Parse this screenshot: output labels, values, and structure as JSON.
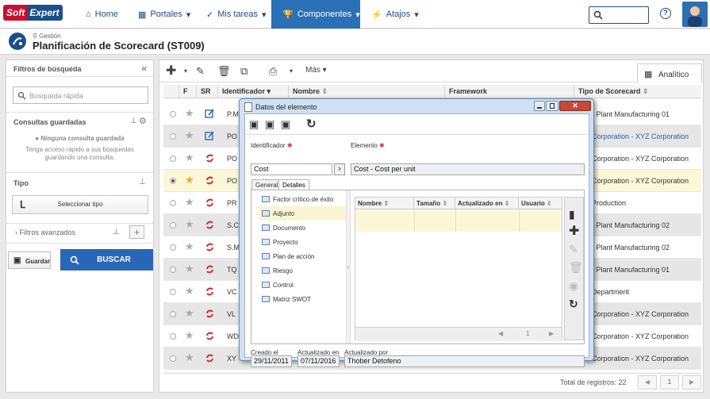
{
  "header": {
    "logo_soft": "Soft",
    "logo_expert": "Expert",
    "nav": [
      {
        "icon": "home-icon",
        "label": "Home"
      },
      {
        "icon": "grid-icon",
        "label": "Portales"
      },
      {
        "icon": "check-icon",
        "label": "Mis tareas"
      },
      {
        "icon": "trophy-icon",
        "label": "Componentes"
      },
      {
        "icon": "bolt-icon",
        "label": "Atajos"
      }
    ]
  },
  "page": {
    "breadcrumb": "Gestión",
    "title": "Planificación de Scorecard (ST009)"
  },
  "left_panel": {
    "title": "Filtros de búsqueda",
    "quick_search_placeholder": "Búsqueda rápida",
    "saved_title": "Consultas guardadas",
    "no_saved": "Ninguna consulta guardada",
    "saved_hint_1": "Tenga acceso rápido a sus búsquedas",
    "saved_hint_2": "guardando una consulta.",
    "tipo_title": "Tipo",
    "select_type": "Seleccionar tipo",
    "advanced_filters": "Filtros avanzados",
    "save": "Guardar",
    "search": "BUSCAR"
  },
  "grid": {
    "toolbar_more": "Más",
    "tab_analytic": "Analítico",
    "columns": [
      "F",
      "SR",
      "Identificador",
      "Nombre",
      "Framework",
      "Tipo de Scorecard"
    ],
    "rows": [
      {
        "id": "P.M",
        "tipo": "- Plant Manufacturing 01",
        "star": false,
        "status": "edit",
        "style": "",
        "tipo_blue": false
      },
      {
        "id": "PO",
        "tipo": "Corporation - XYZ Corporation",
        "star": false,
        "status": "edit",
        "style": "alt",
        "tipo_blue": true
      },
      {
        "id": "PO",
        "tipo": "Corporation - XYZ Corporation",
        "star": false,
        "status": "cycle",
        "style": "",
        "tipo_blue": false
      },
      {
        "id": "PO",
        "tipo": "Corporation - XYZ Corporation",
        "star": true,
        "status": "cycle",
        "style": "sel",
        "tipo_blue": false
      },
      {
        "id": "PR",
        "tipo": "Production",
        "star": false,
        "status": "cycle",
        "style": "",
        "tipo_blue": false
      },
      {
        "id": "S.C",
        "tipo": "- Plant Manufacturing 02",
        "star": false,
        "status": "cycle",
        "style": "alt",
        "tipo_blue": false
      },
      {
        "id": "S.M",
        "tipo": "- Plant Manufacturing 02",
        "star": false,
        "status": "cycle",
        "style": "",
        "tipo_blue": false
      },
      {
        "id": "TQ",
        "tipo": "- Plant Manufacturing 01",
        "star": false,
        "status": "cycle",
        "style": "alt",
        "tipo_blue": false
      },
      {
        "id": "VC",
        "tipo": "Department",
        "star": false,
        "status": "cycle",
        "style": "",
        "tipo_blue": false
      },
      {
        "id": "VL",
        "tipo": "Corporation - XYZ Corporation",
        "star": false,
        "status": "cycle",
        "style": "alt",
        "tipo_blue": false
      },
      {
        "id": "WD",
        "tipo": "Corporation - XYZ Corporation",
        "star": false,
        "status": "cycle",
        "style": "",
        "tipo_blue": false
      },
      {
        "id": "XY",
        "tipo": "Corporation - XYZ Corporation",
        "star": false,
        "status": "cycle",
        "style": "alt",
        "tipo_blue": false
      }
    ],
    "total": "Total de registros: 22",
    "page": "1"
  },
  "dialog": {
    "title": "Datos del elemento",
    "identifier_label": "Identificador",
    "identifier_value": "Cost",
    "element_label": "Elemento",
    "element_value": "Cost - Cost per unit",
    "tab_general": "General",
    "tab_details": "Detalles",
    "nav_items": [
      "Factor crítico de éxito",
      "Adjunto",
      "Documento",
      "Proyecto",
      "Plan de acción",
      "Riesgo",
      "Control",
      "Matriz SWOT"
    ],
    "attach_columns": [
      "Nombre",
      "Tamaño",
      "Actualizado en",
      "Usuario"
    ],
    "page": "1",
    "created_label": "Creado el",
    "created_value": "29/11/2011",
    "updated_label": "Actualizado en",
    "updated_value": "07/11/2016",
    "updated_by_label": "Actualizado por",
    "updated_by_value": "Thober Detofeno"
  }
}
